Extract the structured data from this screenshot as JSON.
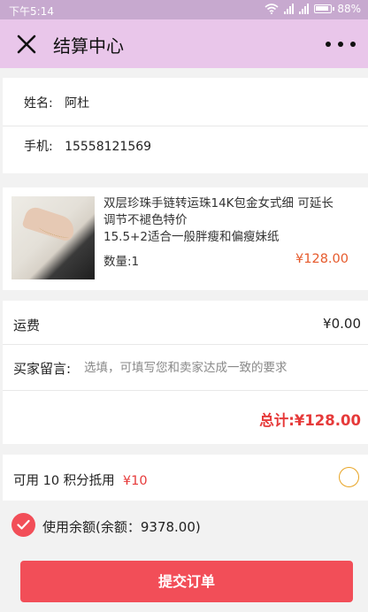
{
  "status_bar": {
    "time": "下午5:14",
    "battery": "88%"
  },
  "header": {
    "title": "结算中心"
  },
  "buyer": {
    "name_label": "姓名:",
    "name": "阿杜",
    "phone_label": "手机:",
    "phone": "15558121569"
  },
  "product": {
    "title_line1": "双层珍珠手链转运珠14K包金女式细 可延长",
    "title_line2": "调节不褪色特价",
    "title_line3": "15.5+2适合一般胖瘦和偏瘦妹纸",
    "quantity": "数量:1",
    "price": "¥128.00"
  },
  "summary": {
    "shipping_label": "运费",
    "shipping_value": "¥0.00",
    "message_label": "买家留言:",
    "message_placeholder": "选填，可填写您和卖家达成一致的要求",
    "total": "总计:¥128.00"
  },
  "points": {
    "label": "可用 10 积分抵用",
    "amount": "¥10",
    "selected": false
  },
  "balance": {
    "label": "使用余额(余额：9378.00)",
    "checked": true
  },
  "submit_label": "提交订单",
  "colors": {
    "accent": "#f24e58",
    "header_bg": "#e9c6ea",
    "price": "#e65a2c",
    "total": "#e63a3a"
  }
}
